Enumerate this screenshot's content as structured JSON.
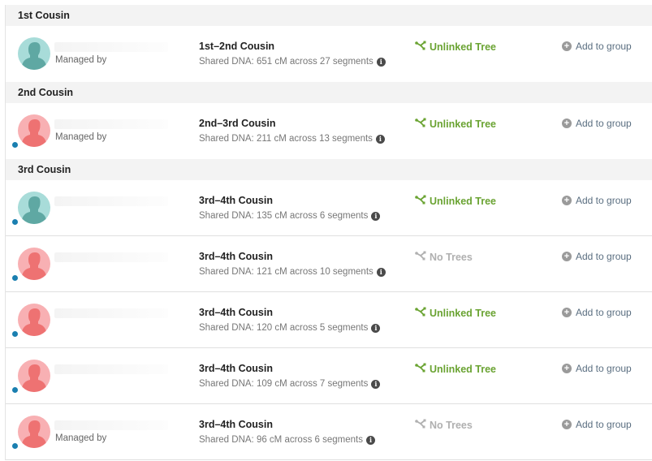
{
  "colors": {
    "linked_tree": "#6aa332",
    "no_tree": "#b0b0b0",
    "avatar_male_bg": "#a8dcd9",
    "avatar_male_fg": "#5fa8a3",
    "avatar_female_bg": "#f8b0b3",
    "avatar_female_fg": "#ee7272",
    "new_dot": "#1a7fb0"
  },
  "groups": [
    {
      "title": "1st Cousin",
      "matches": [
        {
          "avatar": "male",
          "new": false,
          "managed_label": "Managed by",
          "relationship": "1st–2nd Cousin",
          "shared_dna": "Shared DNA: 651 cM across 27 segments",
          "tree_status": "Unlinked Tree",
          "tree_type": "linked",
          "add_label": "Add to group"
        }
      ]
    },
    {
      "title": "2nd Cousin",
      "matches": [
        {
          "avatar": "female",
          "new": true,
          "managed_label": "Managed by",
          "relationship": "2nd–3rd Cousin",
          "shared_dna": "Shared DNA: 211 cM across 13 segments",
          "tree_status": "Unlinked Tree",
          "tree_type": "linked",
          "add_label": "Add to group"
        }
      ]
    },
    {
      "title": "3rd Cousin",
      "matches": [
        {
          "avatar": "male",
          "new": true,
          "managed_label": "",
          "relationship": "3rd–4th Cousin",
          "shared_dna": "Shared DNA: 135 cM across 6 segments",
          "tree_status": "Unlinked Tree",
          "tree_type": "linked",
          "add_label": "Add to group"
        },
        {
          "avatar": "female",
          "new": true,
          "managed_label": "",
          "relationship": "3rd–4th Cousin",
          "shared_dna": "Shared DNA: 121 cM across 10 segments",
          "tree_status": "No Trees",
          "tree_type": "none",
          "add_label": "Add to group"
        },
        {
          "avatar": "female",
          "new": true,
          "managed_label": "",
          "relationship": "3rd–4th Cousin",
          "shared_dna": "Shared DNA: 120 cM across 5 segments",
          "tree_status": "Unlinked Tree",
          "tree_type": "linked",
          "add_label": "Add to group"
        },
        {
          "avatar": "female",
          "new": true,
          "managed_label": "",
          "relationship": "3rd–4th Cousin",
          "shared_dna": "Shared DNA: 109 cM across 7 segments",
          "tree_status": "Unlinked Tree",
          "tree_type": "linked",
          "add_label": "Add to group"
        },
        {
          "avatar": "female",
          "new": true,
          "managed_label": "Managed by",
          "relationship": "3rd–4th Cousin",
          "shared_dna": "Shared DNA: 96 cM across 6 segments",
          "tree_status": "No Trees",
          "tree_type": "none",
          "add_label": "Add to group"
        }
      ]
    }
  ],
  "icons": {
    "info": "i",
    "plus": "+"
  }
}
